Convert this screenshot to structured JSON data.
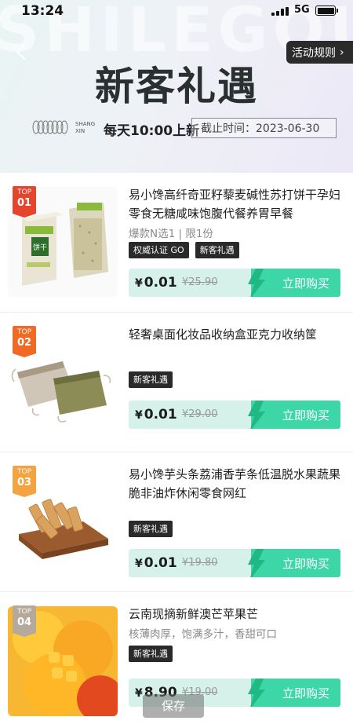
{
  "status_bar": {
    "time": "13:24",
    "network": "5G"
  },
  "header": {
    "watermark": "SHILEGOU",
    "title": "新客礼遇",
    "rules_label": "活动规则",
    "brand_line1": "SHANG",
    "brand_line2": "XIN",
    "daily_text": "每天10:00上新",
    "deadline_text": "截止时间：2023-06-30"
  },
  "products": [
    {
      "rank_label": "TOP",
      "rank_num": "01",
      "rank_color": "#e5442d",
      "title": "易小馋高纤奇亚籽藜麦碱性苏打饼干孕妇零食无糖咸味饱腹代餐养胃早餐",
      "subtitle": "爆款N选1 | 限1份",
      "tags": [
        "权威认证 GO",
        "新客礼遇"
      ],
      "price": "0.01",
      "currency": "¥",
      "old_price": "¥25.90",
      "buy_label": "立即购买"
    },
    {
      "rank_label": "TOP",
      "rank_num": "02",
      "rank_color": "#f06a24",
      "title": "轻奢桌面化妆品收纳盒亚克力收纳筐",
      "subtitle": "",
      "tags": [
        "新客礼遇"
      ],
      "price": "0.01",
      "currency": "¥",
      "old_price": "¥29.00",
      "buy_label": "立即购买"
    },
    {
      "rank_label": "TOP",
      "rank_num": "03",
      "rank_color": "#f5a341",
      "title": "易小馋芋头条荔浦香芋条低温脱水果蔬果脆非油炸休闲零食网红",
      "subtitle": "",
      "tags": [
        "新客礼遇"
      ],
      "price": "0.01",
      "currency": "¥",
      "old_price": "¥19.80",
      "buy_label": "立即购买"
    },
    {
      "rank_label": "TOP",
      "rank_num": "04",
      "rank_color": "#b5a99b",
      "title": "云南现摘新鲜澳芒苹果芒",
      "subtitle": "核薄肉厚，饱满多汁，香甜可口",
      "tags": [
        "新客礼遇"
      ],
      "price": "8.90",
      "currency": "¥",
      "old_price": "¥19.00",
      "buy_label": "立即购买"
    }
  ],
  "save_label": "保存"
}
